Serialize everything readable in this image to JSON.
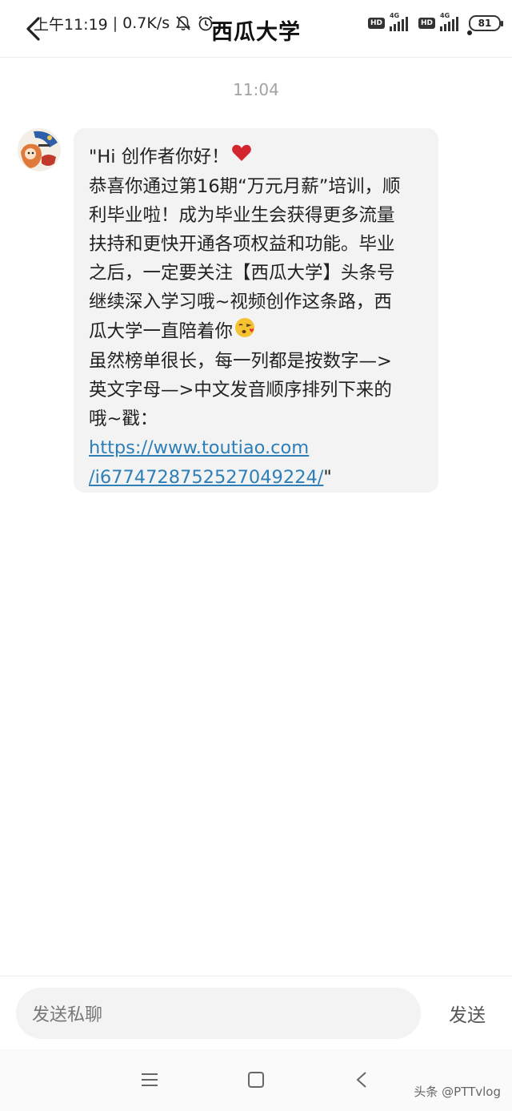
{
  "status_bar": {
    "time": "上午11:19",
    "separator": "|",
    "speed": "0.7K/s",
    "hd1": "HD",
    "net1": "4G",
    "hd2": "HD",
    "net2": "4G",
    "battery": "81"
  },
  "header": {
    "title": "西瓜大学"
  },
  "conversation": {
    "timestamp": "11:04",
    "message": {
      "lines": [
        "\"Hi 创作者你好！",
        "恭喜你通过第16期“万元月薪”培训，顺",
        "利毕业啦！成为毕业生会获得更多流量",
        "扶持和更快开通各项权益和功能。毕业",
        "之后，一定要关注【西瓜大学】头条号",
        "继续深入学习哦~视频创作这条路，西",
        "瓜大学一直陪着你",
        "虽然榜单很长，每一列都是按数字—>",
        "英文字母—>中文发音顺序排列下来的",
        "哦~戳："
      ],
      "link_line1": "https://www.toutiao.com",
      "link_line2": "/i6774728752527049224/",
      "closing_quote": "\""
    }
  },
  "composer": {
    "placeholder": "发送私聊",
    "send_label": "发送"
  },
  "watermark": "头条 @PTTvlog",
  "colors": {
    "bubble_bg": "#f3f3f3",
    "link": "#2e7fb8",
    "timestamp": "#a3a3a3",
    "heart": "#d4262f"
  }
}
